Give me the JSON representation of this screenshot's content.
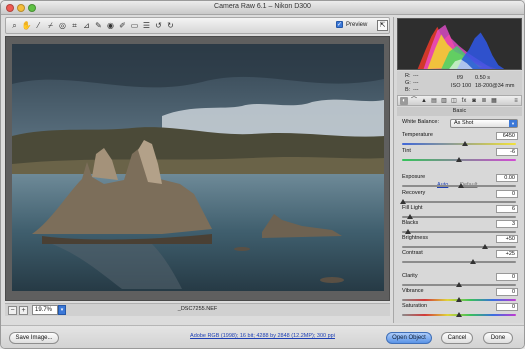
{
  "window": {
    "title": "Camera Raw 6.1  –  Nikon D300"
  },
  "toolbar": {
    "tools": [
      "zoom-tool-icon",
      "hand-tool-icon",
      "white-balance-tool-icon",
      "color-sampler-tool-icon",
      "targeted-adjustment-tool-icon",
      "crop-tool-icon",
      "straighten-tool-icon",
      "spot-removal-tool-icon",
      "red-eye-tool-icon",
      "adjustment-brush-icon",
      "graduated-filter-icon",
      "preferences-icon",
      "rotate-ccw-icon",
      "rotate-cw-icon"
    ],
    "preview_label": "Preview",
    "preview_checked": true
  },
  "status": {
    "zoom_value": "19.7%",
    "filename": "_DSC7255.NEF"
  },
  "readout": {
    "r_label": "R:",
    "g_label": "G:",
    "b_label": "B:",
    "r": "---",
    "g": "---",
    "b": "---",
    "aperture": "f/9",
    "shutter": "0.50 s",
    "iso": "ISO 100",
    "lens": "18-200@34 mm"
  },
  "panel": {
    "title": "Basic",
    "white_balance_label": "White Balance:",
    "white_balance_value": "As Shot",
    "auto_label": "Auto",
    "default_label": "Default",
    "controls": [
      {
        "label": "Temperature",
        "value": "6450"
      },
      {
        "label": "Tint",
        "value": "-6"
      },
      {
        "label": "Exposure",
        "value": "0.00"
      },
      {
        "label": "Recovery",
        "value": "0"
      },
      {
        "label": "Fill Light",
        "value": "6"
      },
      {
        "label": "Blacks",
        "value": "3"
      },
      {
        "label": "Brightness",
        "value": "+50"
      },
      {
        "label": "Contrast",
        "value": "+25"
      },
      {
        "label": "Clarity",
        "value": "0"
      },
      {
        "label": "Vibrance",
        "value": "0"
      },
      {
        "label": "Saturation",
        "value": "0"
      }
    ]
  },
  "bottom": {
    "save_label": "Save Image...",
    "workflow_link": "Adobe RGB (1998); 16 bit; 4288 by 2848 (12.2MP); 300 ppi",
    "open_label": "Open Object",
    "cancel_label": "Cancel",
    "done_label": "Done"
  },
  "colors": {
    "accent": "#3b78d8",
    "link": "#1d3fb4"
  }
}
